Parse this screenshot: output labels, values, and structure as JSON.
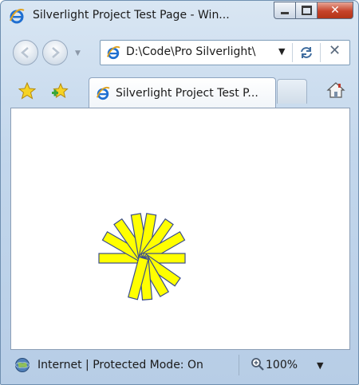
{
  "window": {
    "title": "Silverlight Project Test Page - Win...",
    "caption_buttons": [
      "minimize-icon",
      "maximize-icon",
      "close-icon"
    ]
  },
  "navigation": {
    "address": "D:\\Code\\Pro Silverlight\\",
    "back_icon": "back-arrow-icon",
    "forward_icon": "forward-arrow-icon",
    "refresh_icon": "refresh-icon",
    "stop_icon": "stop-icon"
  },
  "tabs": {
    "active_tab_label": "Silverlight Project Test P...",
    "favorites_icon": "favorites-star-icon",
    "add_favorites_icon": "add-favorites-icon",
    "home_icon": "home-icon"
  },
  "content": {
    "drawing": "pinwheel",
    "fill_color": "#ffff00",
    "stroke_color": "#3b4d8c"
  },
  "status": {
    "zone_text": "Internet | Protected Mode: On",
    "zoom": "100%"
  },
  "colors": {
    "close_button": "#c6432a",
    "chrome": "#c3d7ec"
  }
}
